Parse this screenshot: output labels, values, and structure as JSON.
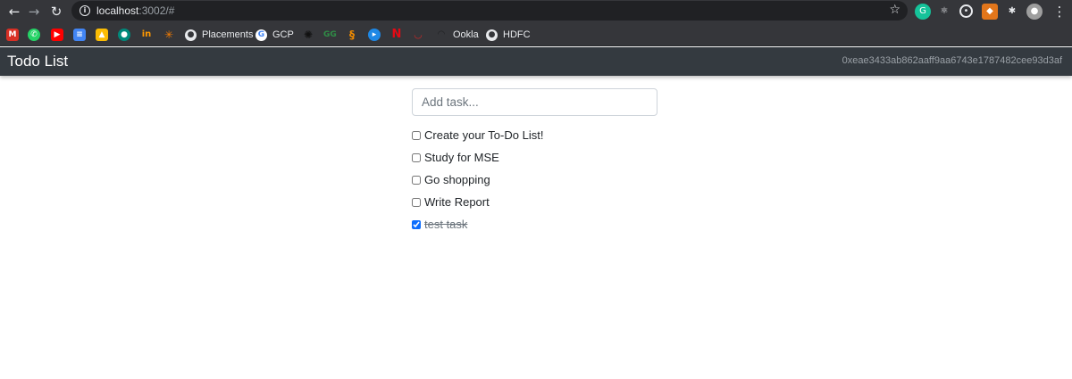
{
  "browser": {
    "url_host": "localhost",
    "url_path": ":3002/#",
    "bookmarks": [
      {
        "label": "",
        "icon": "gmail-icon",
        "color": "#d93025"
      },
      {
        "label": "",
        "icon": "whatsapp-icon",
        "color": "#25d366"
      },
      {
        "label": "",
        "icon": "youtube-icon",
        "color": "#ff0000"
      },
      {
        "label": "",
        "icon": "docs-icon",
        "color": "#4285f4"
      },
      {
        "label": "",
        "icon": "drive-icon",
        "color": "#fbbc04"
      },
      {
        "label": "",
        "icon": "meet-icon",
        "color": "#00897b"
      },
      {
        "label": "",
        "icon": "invision-icon",
        "color": "#ff3366"
      },
      {
        "label": "",
        "icon": "sparkle-icon",
        "color": "#f57c00"
      },
      {
        "label": "Placements",
        "icon": "globe-icon"
      },
      {
        "label": "GCP",
        "icon": "google-icon"
      },
      {
        "label": "",
        "icon": "bug-icon",
        "color": "#000000"
      },
      {
        "label": "",
        "icon": "gfg-icon",
        "color": "#2f8d46"
      },
      {
        "label": "",
        "icon": "code-icon",
        "color": "#f28c00"
      },
      {
        "label": "",
        "icon": "play-icon",
        "color": "#1e88e5"
      },
      {
        "label": "",
        "icon": "netflix-icon",
        "color": "#e50914"
      },
      {
        "label": "",
        "icon": "gauge-icon",
        "color": "#c62828"
      },
      {
        "label": "Ookla",
        "icon": "ookla-icon"
      },
      {
        "label": "HDFC",
        "icon": "globe-icon"
      }
    ]
  },
  "app": {
    "brand": "Todo List",
    "account": "0xeae3433ab862aaff9aa6743e1787482cee93d3af",
    "input_placeholder": "Add task...",
    "tasks": [
      {
        "label": "Create your To-Do List!",
        "completed": false
      },
      {
        "label": "Study for MSE",
        "completed": false
      },
      {
        "label": "Go shopping",
        "completed": false
      },
      {
        "label": "Write Report",
        "completed": false
      },
      {
        "label": "test task",
        "completed": true
      }
    ]
  }
}
